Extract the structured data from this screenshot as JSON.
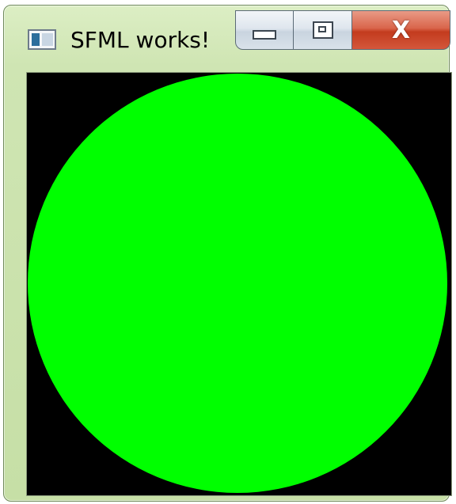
{
  "window": {
    "title": "SFML works!",
    "icon": "app-window-icon",
    "controls": {
      "minimize": "minimize-icon",
      "maximize": "maximize-icon",
      "close_glyph": "X"
    }
  },
  "canvas": {
    "background_color": "#000000",
    "shape": {
      "type": "circle",
      "fill_color": "#00ff00"
    }
  }
}
